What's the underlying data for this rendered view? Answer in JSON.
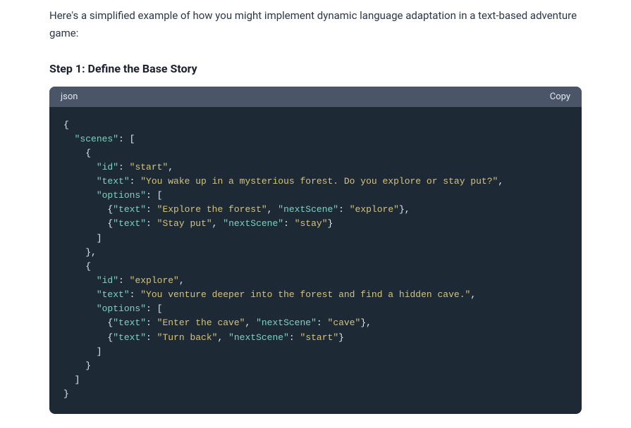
{
  "intro": "Here's a simplified example of how you might implement dynamic language adaptation in a text-based adventure game:",
  "step_heading": "Step 1: Define the Base Story",
  "code": {
    "lang": "json",
    "copy_label": "Copy",
    "tokens": [
      {
        "t": "p",
        "v": "{\n  "
      },
      {
        "t": "k",
        "v": "\"scenes\""
      },
      {
        "t": "p",
        "v": ": [\n    {\n      "
      },
      {
        "t": "k",
        "v": "\"id\""
      },
      {
        "t": "p",
        "v": ": "
      },
      {
        "t": "s",
        "v": "\"start\""
      },
      {
        "t": "p",
        "v": ",\n      "
      },
      {
        "t": "k",
        "v": "\"text\""
      },
      {
        "t": "p",
        "v": ": "
      },
      {
        "t": "s",
        "v": "\"You wake up in a mysterious forest. Do you explore or stay put?\""
      },
      {
        "t": "p",
        "v": ",\n      "
      },
      {
        "t": "k",
        "v": "\"options\""
      },
      {
        "t": "p",
        "v": ": [\n        {"
      },
      {
        "t": "k",
        "v": "\"text\""
      },
      {
        "t": "p",
        "v": ": "
      },
      {
        "t": "s",
        "v": "\"Explore the forest\""
      },
      {
        "t": "p",
        "v": ", "
      },
      {
        "t": "k",
        "v": "\"nextScene\""
      },
      {
        "t": "p",
        "v": ": "
      },
      {
        "t": "s",
        "v": "\"explore\""
      },
      {
        "t": "p",
        "v": "},\n        {"
      },
      {
        "t": "k",
        "v": "\"text\""
      },
      {
        "t": "p",
        "v": ": "
      },
      {
        "t": "s",
        "v": "\"Stay put\""
      },
      {
        "t": "p",
        "v": ", "
      },
      {
        "t": "k",
        "v": "\"nextScene\""
      },
      {
        "t": "p",
        "v": ": "
      },
      {
        "t": "s",
        "v": "\"stay\""
      },
      {
        "t": "p",
        "v": "}\n      ]\n    },\n    {\n      "
      },
      {
        "t": "k",
        "v": "\"id\""
      },
      {
        "t": "p",
        "v": ": "
      },
      {
        "t": "s",
        "v": "\"explore\""
      },
      {
        "t": "p",
        "v": ",\n      "
      },
      {
        "t": "k",
        "v": "\"text\""
      },
      {
        "t": "p",
        "v": ": "
      },
      {
        "t": "s",
        "v": "\"You venture deeper into the forest and find a hidden cave.\""
      },
      {
        "t": "p",
        "v": ",\n      "
      },
      {
        "t": "k",
        "v": "\"options\""
      },
      {
        "t": "p",
        "v": ": [\n        {"
      },
      {
        "t": "k",
        "v": "\"text\""
      },
      {
        "t": "p",
        "v": ": "
      },
      {
        "t": "s",
        "v": "\"Enter the cave\""
      },
      {
        "t": "p",
        "v": ", "
      },
      {
        "t": "k",
        "v": "\"nextScene\""
      },
      {
        "t": "p",
        "v": ": "
      },
      {
        "t": "s",
        "v": "\"cave\""
      },
      {
        "t": "p",
        "v": "},\n        {"
      },
      {
        "t": "k",
        "v": "\"text\""
      },
      {
        "t": "p",
        "v": ": "
      },
      {
        "t": "s",
        "v": "\"Turn back\""
      },
      {
        "t": "p",
        "v": ", "
      },
      {
        "t": "k",
        "v": "\"nextScene\""
      },
      {
        "t": "p",
        "v": ": "
      },
      {
        "t": "s",
        "v": "\"start\""
      },
      {
        "t": "p",
        "v": "}\n      ]\n    }\n  ]\n}"
      }
    ]
  }
}
